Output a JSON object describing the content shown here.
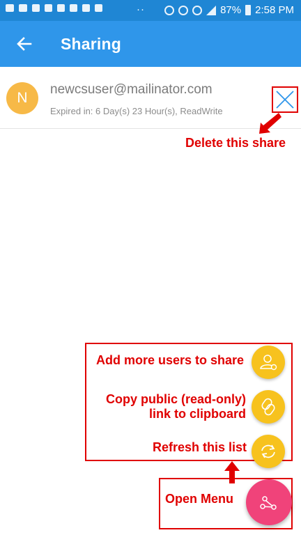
{
  "status_bar": {
    "battery": "87%",
    "time": "2:58 PM",
    "dots": "··"
  },
  "app_bar": {
    "title": "Sharing"
  },
  "share_item": {
    "avatar_letter": "N",
    "email": "newcsuser@mailinator.com",
    "expiry": "Expired in: 6 Day(s) 23 Hour(s), ReadWrite"
  },
  "annotations": {
    "delete": "Delete this share",
    "add_users": "Add more users to share",
    "copy_link_line1": "Copy public (read-only)",
    "copy_link_line2": "link to clipboard",
    "refresh": "Refresh this list",
    "open_menu": "Open Menu"
  },
  "colors": {
    "app_bar": "#2f96ea",
    "status_bar": "#1f86d4",
    "avatar": "#f7b947",
    "fab_small": "#f7c21e",
    "fab_main": "#f0437a",
    "annotation": "#e00000"
  },
  "icons": {
    "back": "arrow-left-icon",
    "delete": "close-x-icon",
    "add_users": "add-user-icon",
    "copy_link": "link-icon",
    "refresh": "refresh-icon",
    "menu": "share-nodes-icon"
  }
}
